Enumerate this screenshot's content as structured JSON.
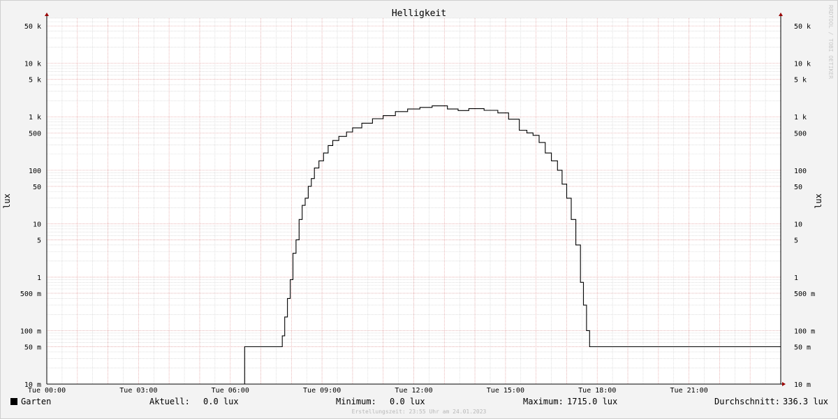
{
  "chart_data": {
    "type": "line",
    "title": "Helligkeit",
    "ylabel": "lux",
    "yscale": "log",
    "ylim": [
      0.01,
      70000
    ],
    "xlim_hours": [
      0,
      24
    ],
    "x_ticks": [
      "Tue 00:00",
      "Tue 03:00",
      "Tue 06:00",
      "Tue 09:00",
      "Tue 12:00",
      "Tue 15:00",
      "Tue 18:00",
      "Tue 21:00"
    ],
    "y_ticks": [
      {
        "value": 50000,
        "label": "50 k"
      },
      {
        "value": 10000,
        "label": "10 k"
      },
      {
        "value": 5000,
        "label": "5 k"
      },
      {
        "value": 1000,
        "label": "1 k"
      },
      {
        "value": 500,
        "label": "500"
      },
      {
        "value": 100,
        "label": "100"
      },
      {
        "value": 50,
        "label": "50"
      },
      {
        "value": 10,
        "label": "10"
      },
      {
        "value": 5,
        "label": "5"
      },
      {
        "value": 1,
        "label": "1"
      },
      {
        "value": 0.5,
        "label": "500 m"
      },
      {
        "value": 0.1,
        "label": "100 m"
      },
      {
        "value": 0.05,
        "label": "50 m"
      },
      {
        "value": 0.01,
        "label": "10 m"
      }
    ],
    "grid": true,
    "legend_position": "bottom-left",
    "series": [
      {
        "name": "Garten",
        "color": "#000000",
        "points": [
          [
            0.0,
            0.01
          ],
          [
            6.45,
            0.01
          ],
          [
            6.47,
            0.05
          ],
          [
            7.6,
            0.05
          ],
          [
            7.7,
            0.08
          ],
          [
            7.78,
            0.18
          ],
          [
            7.87,
            0.4
          ],
          [
            7.96,
            0.9
          ],
          [
            8.05,
            2.8
          ],
          [
            8.15,
            5
          ],
          [
            8.25,
            12
          ],
          [
            8.35,
            22
          ],
          [
            8.45,
            30
          ],
          [
            8.55,
            50
          ],
          [
            8.65,
            70
          ],
          [
            8.75,
            110
          ],
          [
            8.9,
            150
          ],
          [
            9.05,
            210
          ],
          [
            9.2,
            290
          ],
          [
            9.35,
            360
          ],
          [
            9.55,
            430
          ],
          [
            9.8,
            520
          ],
          [
            10.0,
            620
          ],
          [
            10.3,
            760
          ],
          [
            10.65,
            920
          ],
          [
            11.0,
            1050
          ],
          [
            11.4,
            1250
          ],
          [
            11.8,
            1400
          ],
          [
            12.2,
            1500
          ],
          [
            12.6,
            1600
          ],
          [
            13.1,
            1400
          ],
          [
            13.45,
            1310
          ],
          [
            13.8,
            1420
          ],
          [
            14.3,
            1320
          ],
          [
            14.75,
            1180
          ],
          [
            15.1,
            900
          ],
          [
            15.45,
            560
          ],
          [
            15.7,
            500
          ],
          [
            15.9,
            450
          ],
          [
            16.1,
            330
          ],
          [
            16.3,
            210
          ],
          [
            16.5,
            150
          ],
          [
            16.7,
            100
          ],
          [
            16.85,
            55
          ],
          [
            17.0,
            30
          ],
          [
            17.15,
            12
          ],
          [
            17.3,
            4
          ],
          [
            17.45,
            0.8
          ],
          [
            17.55,
            0.3
          ],
          [
            17.65,
            0.1
          ],
          [
            17.75,
            0.05
          ],
          [
            24.0,
            0.05
          ]
        ]
      }
    ],
    "legend": {
      "series_name": "Garten",
      "current_label": "Aktuell:",
      "current_value": "0.0 lux",
      "min_label": "Minimum:",
      "min_value": "0.0 lux",
      "max_label": "Maximum:",
      "max_value": "1715.0 lux",
      "avg_label": "Durchschnitt:",
      "avg_value": "336.3 lux"
    },
    "watermark": "RRDTOOL / TOBI OETIKER",
    "footer": "Erstellungszeit: 23:55 Uhr am 24.01.2023",
    "colors": {
      "background": "#f3f3f3",
      "plot_background": "#ffffff",
      "major_grid": "#e8a0a0",
      "minor_grid": "#cccccc",
      "axis": "#000000",
      "arrow": "#990000"
    }
  }
}
